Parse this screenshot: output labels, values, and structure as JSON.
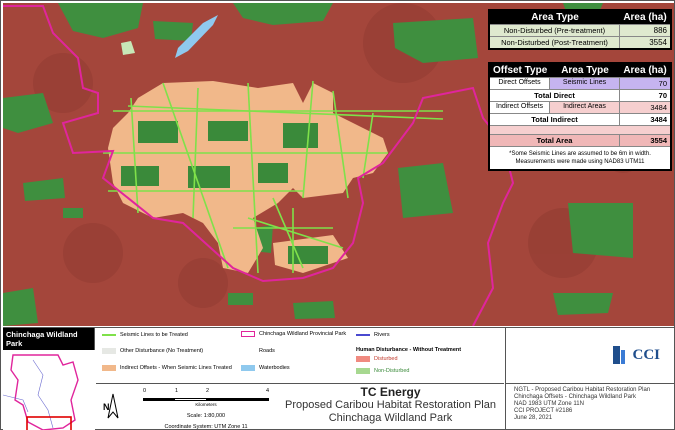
{
  "table_area_type": {
    "headers": [
      "Area Type",
      "Area (ha)"
    ],
    "rows": [
      {
        "type": "Non-Disturbed (Pre-treatment)",
        "area": "886"
      },
      {
        "type": "Non-Disturbed (Post-Treatment)",
        "area": "3554"
      }
    ]
  },
  "table_offset": {
    "headers": [
      "Offset Type",
      "Area Type",
      "Area (ha)"
    ],
    "direct": {
      "offset": "Direct Offsets",
      "type": "Seismic Lines",
      "area": "70"
    },
    "total_direct": {
      "label": "Total Direct",
      "area": "70"
    },
    "indirect": {
      "offset": "Indirect Offsets",
      "type": "Indirect Areas",
      "area": "3484"
    },
    "total_indirect": {
      "label": "Total Indirect",
      "area": "3484"
    },
    "total_area": {
      "label": "Total Area",
      "area": "3554"
    },
    "note_line1": "*Some Seismic Lines are assumed to be 6m in width.",
    "note_line2": "Measurements were made using NAD83 UTM11"
  },
  "inset": {
    "title": "Chinchaga Wildland Park"
  },
  "legend": {
    "seismic": "Seismic Lines to be Treated",
    "other": "Other Disturbance (No Treatment)",
    "indirect": "Indirect Offsets - When Seismic Lines Treated",
    "park": "Chinchaga Wildland Provincial Park",
    "roads": "Roads",
    "waterbodies": "Waterbodies",
    "rivers": "Rivers",
    "human_title": "Human Disturbance - Without Treatment",
    "disturbed": "Disturbed",
    "non_disturbed": "Non-Disturbed"
  },
  "scale": {
    "ticks": [
      "0",
      "1",
      "2",
      "4"
    ],
    "unit": "Kilometers",
    "scale_text": "Scale: 1:80,000",
    "coord": "Coordinate System: UTM Zone 11"
  },
  "north": "N",
  "title": {
    "company": "TC Energy",
    "line1": "Proposed Caribou Habitat Restoration Plan",
    "line2": "Chinchaga Wildland Park"
  },
  "logo": "CCI",
  "info": [
    "NGTL - Proposed Caribou Habitat Restoration Plan",
    "Chinchaga Offsets - Chinchaga Wildland Park",
    "NAD 1983 UTM Zone 11N",
    "CCI PROJECT #2186",
    "June 28, 2021"
  ],
  "colors": {
    "disturbed": "#a4463b",
    "non_disturbed": "#3a8a3a",
    "indirect": "#f1b88a",
    "seismic": "#7fe14a",
    "park_boundary": "#e0259c",
    "water": "#8fc9ee",
    "direct_offset": "#c6b4f0"
  }
}
